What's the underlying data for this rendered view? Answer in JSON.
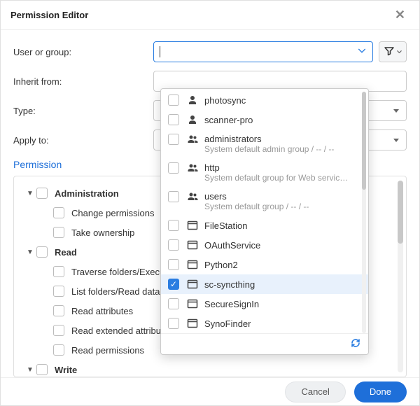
{
  "title": "Permission Editor",
  "form": {
    "user_or_group_label": "User or group:",
    "inherit_from_label": "Inherit from:",
    "type_label": "Type:",
    "apply_to_label": "Apply to:"
  },
  "section": {
    "permission": "Permission"
  },
  "tree": {
    "admin": {
      "label": "Administration",
      "children": {
        "change_permissions": "Change permissions",
        "take_ownership": "Take ownership"
      }
    },
    "read": {
      "label": "Read",
      "children": {
        "traverse": "Traverse folders/Execute files",
        "list": "List folders/Read data",
        "read_attrs": "Read attributes",
        "read_ext_attrs": "Read extended attributes",
        "read_perms": "Read permissions"
      }
    },
    "write": {
      "label": "Write"
    }
  },
  "dropdown": {
    "items": [
      {
        "kind": "user",
        "label": "photosync",
        "sub": null,
        "checked": false
      },
      {
        "kind": "user",
        "label": "scanner-pro",
        "sub": null,
        "checked": false
      },
      {
        "kind": "group",
        "label": "administrators",
        "sub": "System default admin group / -- / --",
        "checked": false
      },
      {
        "kind": "group",
        "label": "http",
        "sub": "System default group for Web servic…",
        "checked": false
      },
      {
        "kind": "group",
        "label": "users",
        "sub": "System default group / -- / --",
        "checked": false
      },
      {
        "kind": "app",
        "label": "FileStation",
        "sub": null,
        "checked": false
      },
      {
        "kind": "app",
        "label": "OAuthService",
        "sub": null,
        "checked": false
      },
      {
        "kind": "app",
        "label": "Python2",
        "sub": null,
        "checked": false
      },
      {
        "kind": "app",
        "label": "sc-syncthing",
        "sub": null,
        "checked": true
      },
      {
        "kind": "app",
        "label": "SecureSignIn",
        "sub": null,
        "checked": false
      },
      {
        "kind": "app",
        "label": "SynoFinder",
        "sub": null,
        "checked": false
      }
    ]
  },
  "footer": {
    "cancel": "Cancel",
    "done": "Done"
  }
}
